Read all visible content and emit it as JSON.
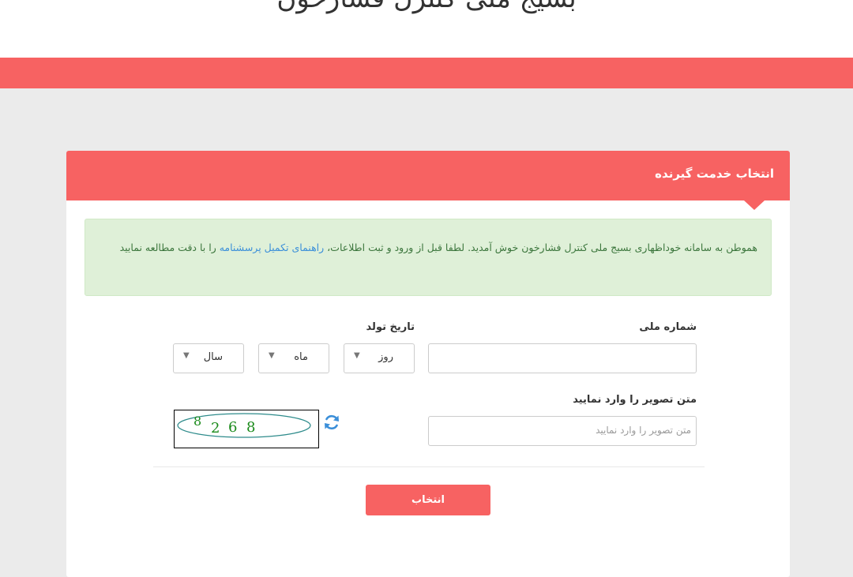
{
  "header": {
    "site_title": "بسیج ملی کنترل فشارخون"
  },
  "card": {
    "title": "انتخاب خدمت گیرنده",
    "alert": {
      "text_before_link": "هموطن به سامانه خوداظهاری بسیج ملی کنترل فشارخون خوش آمدید. لطفا قبل از ورود و ثبت اطلاعات، ",
      "link_text": "راهنمای تکمیل پرسشنامه",
      "text_after_link": " را با دقت مطالعه نمایید"
    }
  },
  "form": {
    "national_id": {
      "label": "شماره ملی",
      "value": ""
    },
    "birth_date": {
      "label": "تاریخ تولد",
      "day": "روز",
      "month": "ماه",
      "year": "سال"
    },
    "captcha": {
      "label": "متن تصویر را وارد نمایید",
      "placeholder": "متن تصویر را وارد نمایید",
      "image_digits": [
        "8",
        "2",
        "6",
        "8"
      ]
    },
    "submit_label": "انتخاب"
  },
  "colors": {
    "primary": "#f76262",
    "page_background": "#ebebeb",
    "alert_background": "#dff0d8",
    "alert_text": "#3c763d",
    "link": "#3b8fd9",
    "refresh_icon": "#3b8fd9",
    "captcha_digits": "#1a8a1a"
  },
  "icons": {
    "refresh": "refresh-icon",
    "dropdown": "caret-down-icon"
  }
}
